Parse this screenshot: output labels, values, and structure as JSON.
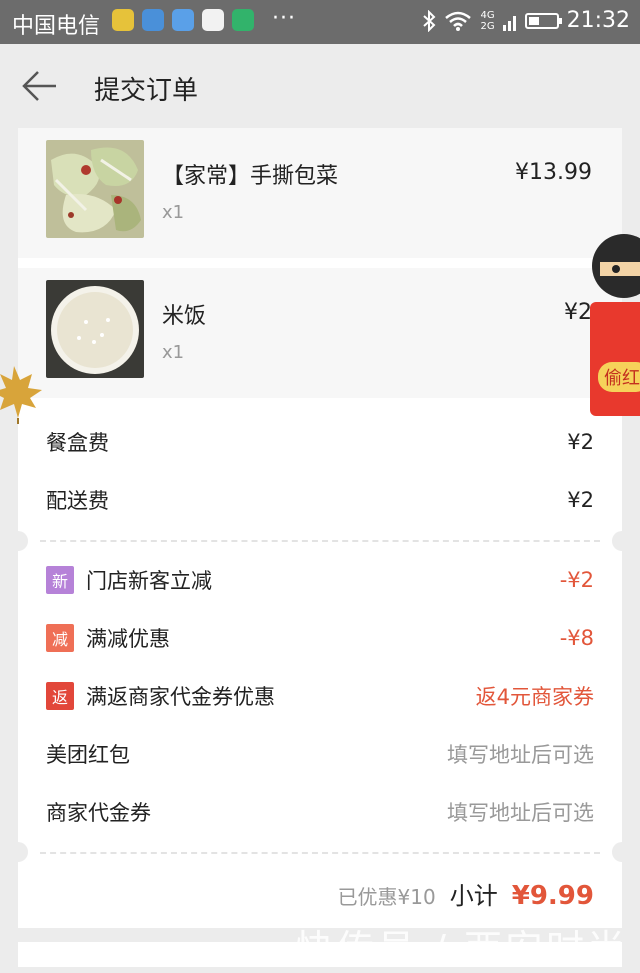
{
  "status_bar": {
    "carrier": "中国电信",
    "dots": "···",
    "net_top": "4G",
    "net_bottom": "2G",
    "battery_percent": 40,
    "time": "21:32"
  },
  "header": {
    "back_icon": "arrow-left-icon",
    "title": "提交订单"
  },
  "order_items": [
    {
      "name": "【家常】手撕包菜",
      "qty": "x1",
      "price": "¥13.99",
      "thumb": "shredded-cabbage-photo"
    },
    {
      "name": "米饭",
      "qty": "x1",
      "price": "¥2",
      "thumb": "rice-bowl-photo"
    }
  ],
  "fees": [
    {
      "label": "餐盒费",
      "value": "¥2"
    },
    {
      "label": "配送费",
      "value": "¥2"
    }
  ],
  "discounts": [
    {
      "tag": "新",
      "tag_color": "#b682d8",
      "label": "门店新客立减",
      "value": "-¥2"
    },
    {
      "tag": "减",
      "tag_color": "#ef6f56",
      "label": "满减优惠",
      "value": "-¥8"
    },
    {
      "tag": "返",
      "tag_color": "#e2473a",
      "label": "满返商家代金券优惠",
      "value": "返4元商家券"
    }
  ],
  "vouchers": [
    {
      "label": "美团红包",
      "value": "填写地址后可选"
    },
    {
      "label": "商家代金券",
      "value": "填写地址后可选"
    }
  ],
  "summary": {
    "saved": "已优惠¥10",
    "subtotal_label": "小计",
    "subtotal_value": "¥9.99"
  },
  "float_redpacket": {
    "label": "偷红",
    "icon": "thief-redpacket-icon"
  },
  "watermark": "快传号 / 西安时尚",
  "colors": {
    "accent_red": "#e2563a",
    "page_bg": "#ececec",
    "card_bg": "#ffffff"
  }
}
